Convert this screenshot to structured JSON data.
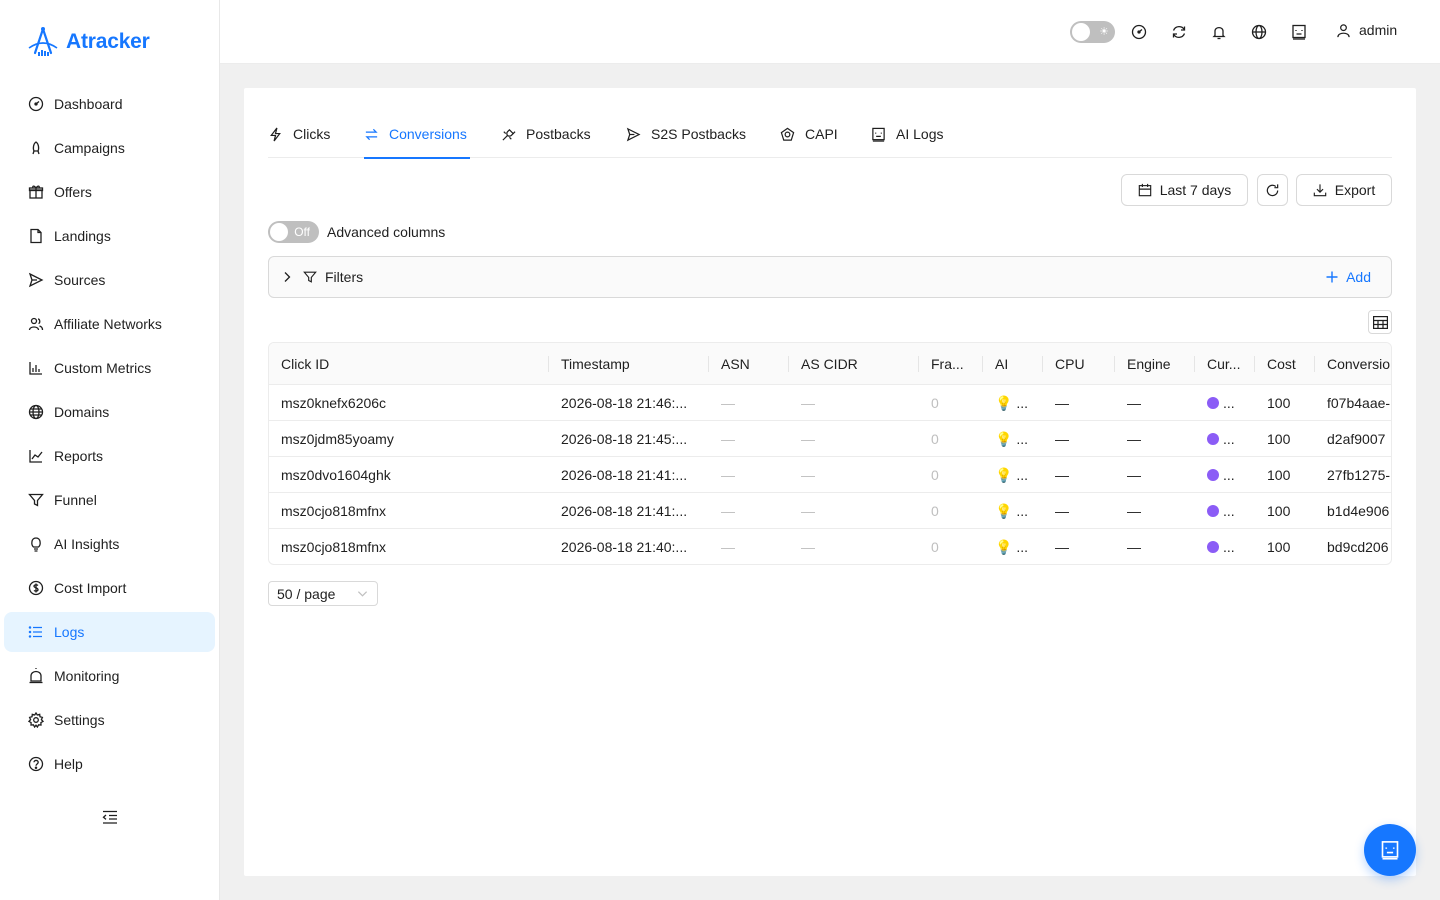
{
  "app": {
    "brand": "Atracker",
    "brand_color": "#1677ff"
  },
  "sidebar": {
    "items": [
      {
        "label": "Dashboard",
        "icon": "dashboard-icon"
      },
      {
        "label": "Campaigns",
        "icon": "rocket-icon"
      },
      {
        "label": "Offers",
        "icon": "gift-icon"
      },
      {
        "label": "Landings",
        "icon": "file-icon"
      },
      {
        "label": "Sources",
        "icon": "send-icon"
      },
      {
        "label": "Affiliate Networks",
        "icon": "users-icon"
      },
      {
        "label": "Custom Metrics",
        "icon": "bar-chart-icon"
      },
      {
        "label": "Domains",
        "icon": "globe-icon"
      },
      {
        "label": "Reports",
        "icon": "line-chart-icon"
      },
      {
        "label": "Funnel",
        "icon": "funnel-icon"
      },
      {
        "label": "AI Insights",
        "icon": "bulb-icon"
      },
      {
        "label": "Cost Import",
        "icon": "dollar-icon"
      },
      {
        "label": "Logs",
        "icon": "list-icon",
        "active": true
      },
      {
        "label": "Monitoring",
        "icon": "alert-icon"
      },
      {
        "label": "Settings",
        "icon": "gear-icon"
      },
      {
        "label": "Help",
        "icon": "help-icon"
      }
    ]
  },
  "header": {
    "user": "admin"
  },
  "tabs": [
    {
      "label": "Clicks",
      "icon": "lightning-icon"
    },
    {
      "label": "Conversions",
      "icon": "swap-icon",
      "active": true
    },
    {
      "label": "Postbacks",
      "icon": "api-icon"
    },
    {
      "label": "S2S Postbacks",
      "icon": "send-icon"
    },
    {
      "label": "CAPI",
      "icon": "meta-icon"
    },
    {
      "label": "AI Logs",
      "icon": "robot-icon"
    }
  ],
  "toolbar": {
    "date_range": "Last 7 days",
    "export_label": "Export"
  },
  "advanced": {
    "switch_text": "Off",
    "label": "Advanced columns"
  },
  "filters": {
    "label": "Filters",
    "add_label": "Add"
  },
  "table": {
    "columns": [
      "Click ID",
      "Timestamp",
      "ASN",
      "AS CIDR",
      "Fra...",
      "AI",
      "CPU",
      "Engine",
      "Cur...",
      "Cost",
      "Conversio"
    ],
    "rows": [
      {
        "click_id": "msz0knefx6206c",
        "timestamp": "2026-08-18 21:46:...",
        "asn": "—",
        "as_cidr": "—",
        "fraud": "0",
        "ai": "...",
        "cpu": "—",
        "engine": "—",
        "cur": "...",
        "cost": "100",
        "conversion": "f07b4aae-"
      },
      {
        "click_id": "msz0jdm85yoamy",
        "timestamp": "2026-08-18 21:45:...",
        "asn": "—",
        "as_cidr": "—",
        "fraud": "0",
        "ai": "...",
        "cpu": "—",
        "engine": "—",
        "cur": "...",
        "cost": "100",
        "conversion": "d2af9007"
      },
      {
        "click_id": "msz0dvo1604ghk",
        "timestamp": "2026-08-18 21:41:...",
        "asn": "—",
        "as_cidr": "—",
        "fraud": "0",
        "ai": "...",
        "cpu": "—",
        "engine": "—",
        "cur": "...",
        "cost": "100",
        "conversion": "27fb1275-"
      },
      {
        "click_id": "msz0cjo818mfnx",
        "timestamp": "2026-08-18 21:41:...",
        "asn": "—",
        "as_cidr": "—",
        "fraud": "0",
        "ai": "...",
        "cpu": "—",
        "engine": "—",
        "cur": "...",
        "cost": "100",
        "conversion": "b1d4e906"
      },
      {
        "click_id": "msz0cjo818mfnx",
        "timestamp": "2026-08-18 21:40:...",
        "asn": "—",
        "as_cidr": "—",
        "fraud": "0",
        "ai": "...",
        "cpu": "—",
        "engine": "—",
        "cur": "...",
        "cost": "100",
        "conversion": "bd9cd206"
      }
    ]
  },
  "pagination": {
    "page_size": "50 / page"
  }
}
